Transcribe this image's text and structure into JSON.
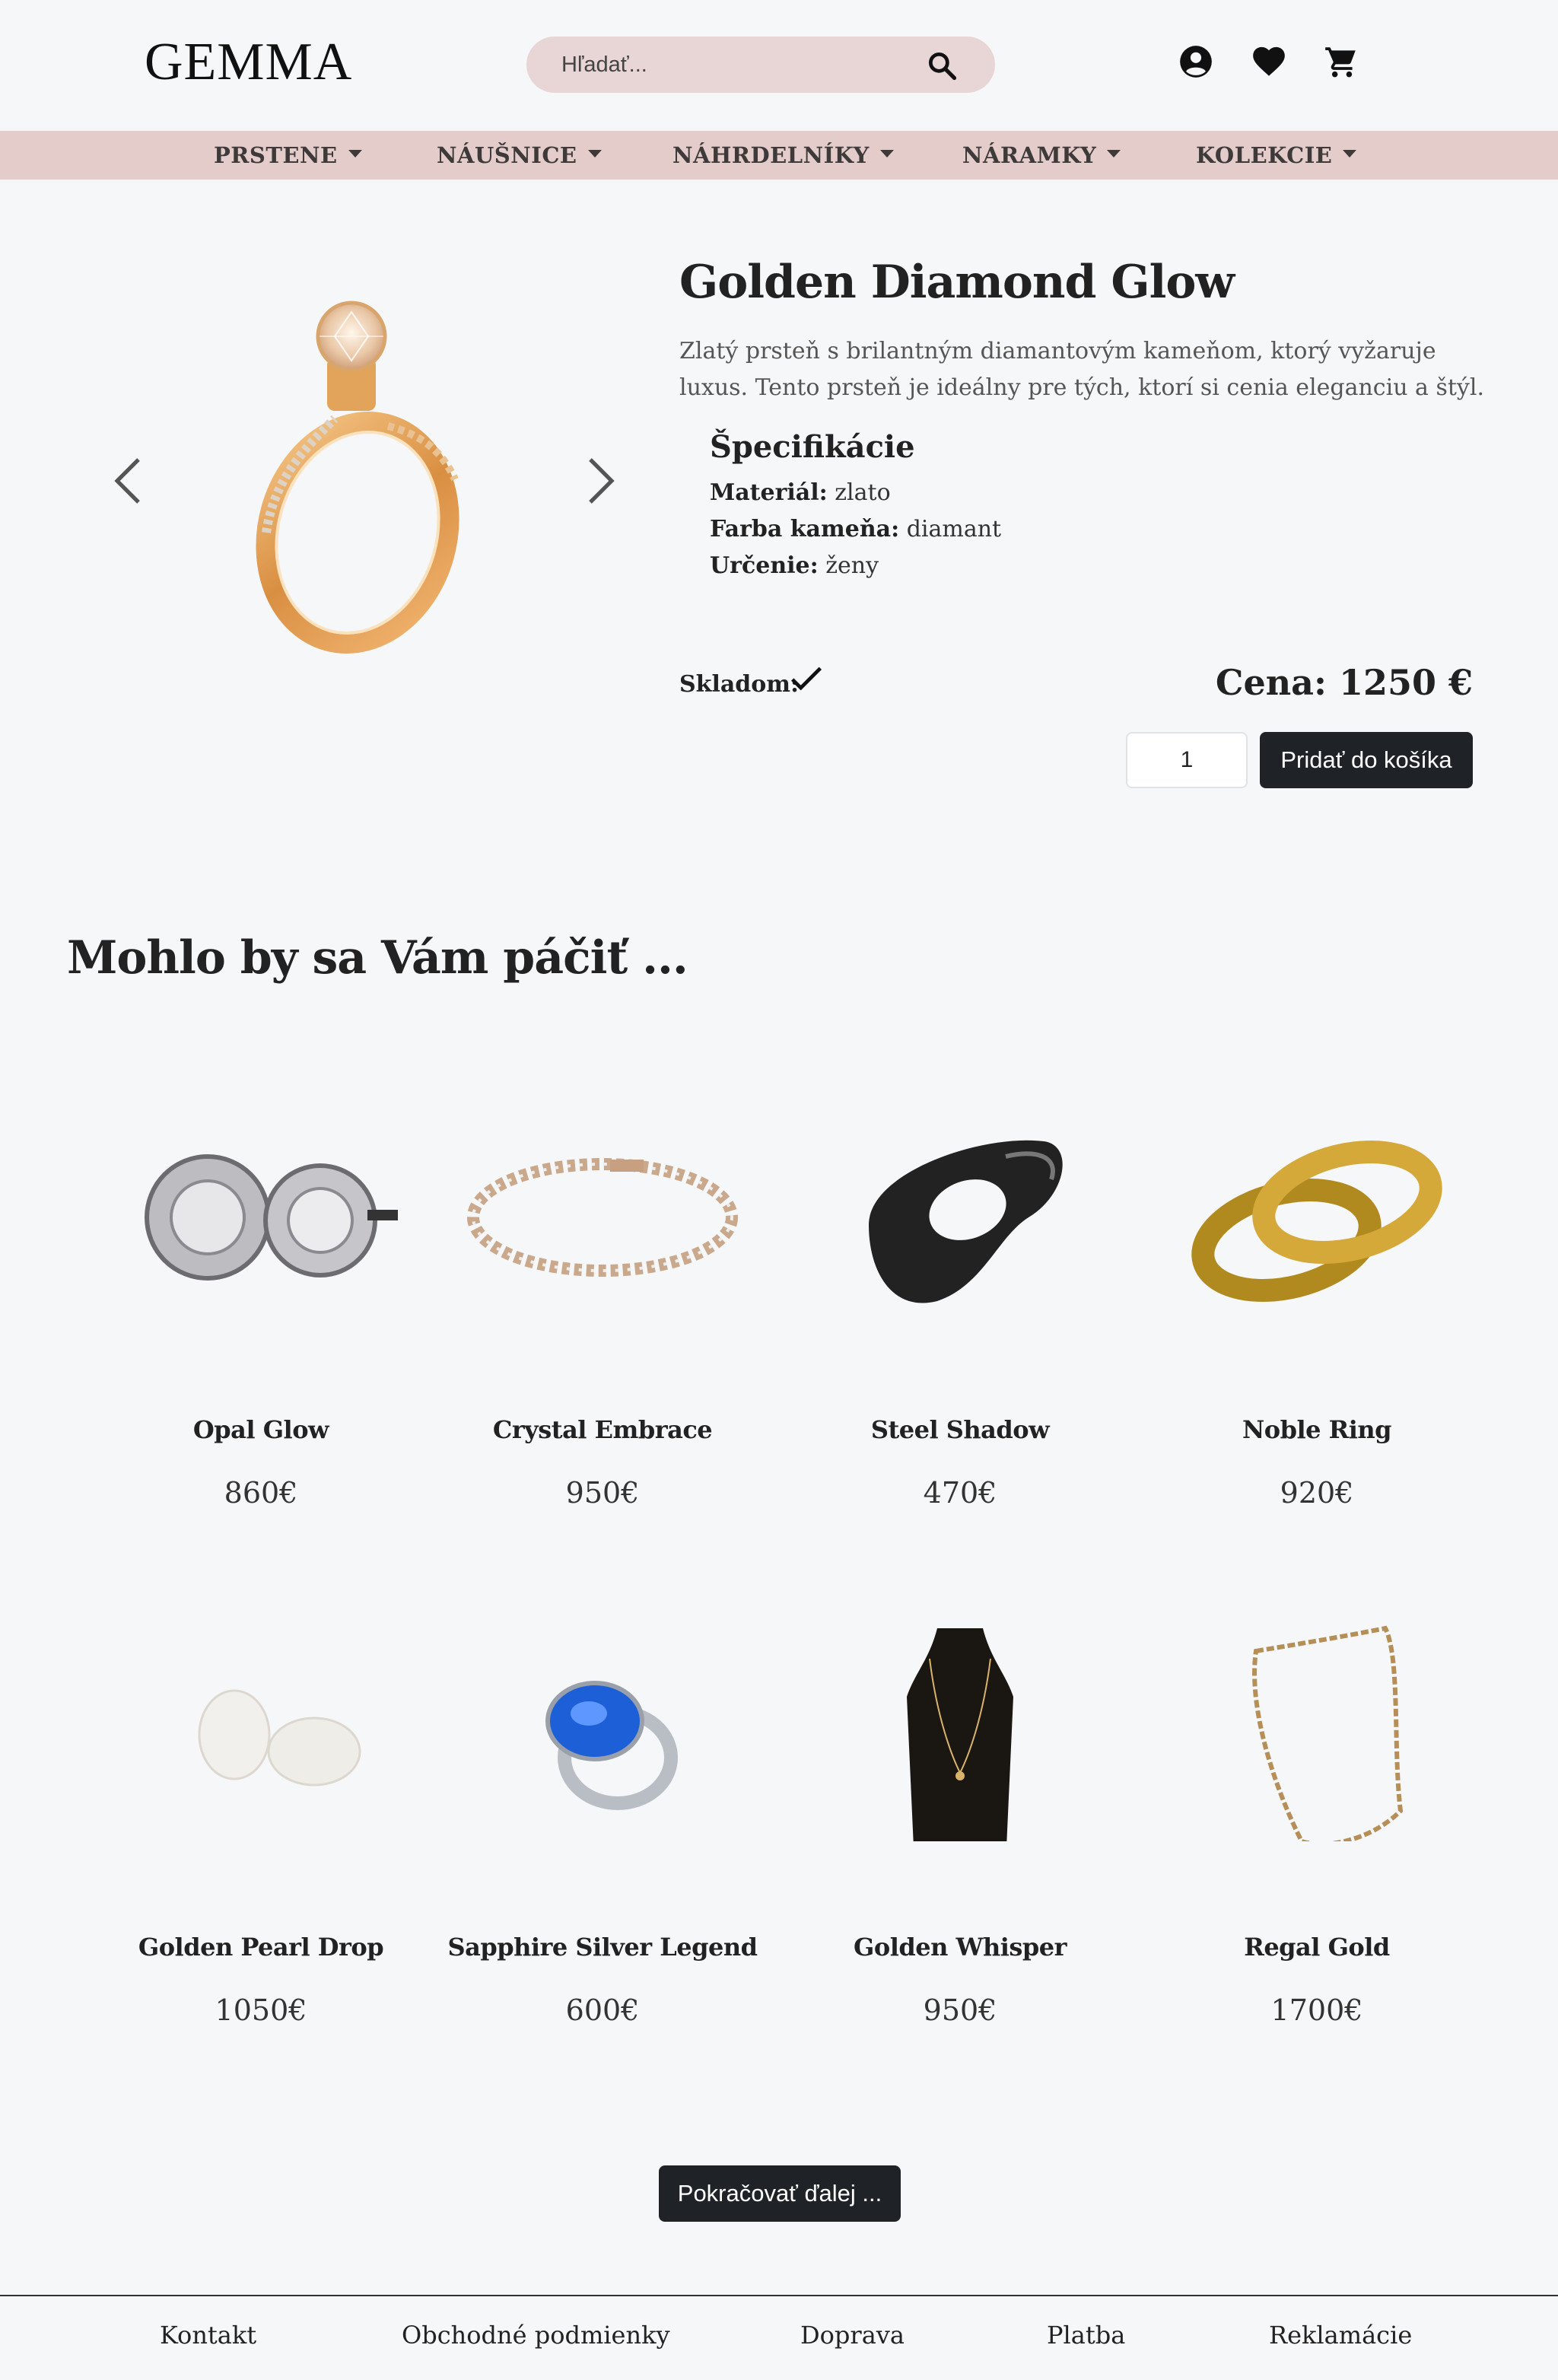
{
  "header": {
    "logo": "GEMMA",
    "search_placeholder": "Hľadať..."
  },
  "nav": [
    {
      "label": "PRSTENE"
    },
    {
      "label": "NÁUŠNICE"
    },
    {
      "label": "NÁHRDELNÍKY"
    },
    {
      "label": "NÁRAMKY"
    },
    {
      "label": "KOLEKCIE"
    }
  ],
  "product": {
    "title": "Golden Diamond Glow",
    "description": "Zlatý prsteň s brilantným diamantovým kameňom, ktorý vyžaruje luxus. Tento prsteň je ideálny pre tých, ktorí si cenia eleganciu a štýl.",
    "spec_title": "Špecifikácie",
    "specs": [
      {
        "label": "Materiál:",
        "value": "zlato"
      },
      {
        "label": "Farba kameňa:",
        "value": "diamant"
      },
      {
        "label": "Určenie:",
        "value": "ženy"
      }
    ],
    "stock_label": "Skladom:",
    "price": "Cena: 1250 €",
    "quantity": "1",
    "add_button": "Pridať do košíka"
  },
  "recommended": {
    "title": "Mohlo by sa Vám páčiť ...",
    "items": [
      {
        "name": "Opal Glow",
        "price": "860€",
        "icon": "earrings-icon"
      },
      {
        "name": "Crystal Embrace",
        "price": "950€",
        "icon": "bracelet-icon"
      },
      {
        "name": "Steel Shadow",
        "price": "470€",
        "icon": "ring-icon"
      },
      {
        "name": "Noble Ring",
        "price": "920€",
        "icon": "ring-icon"
      },
      {
        "name": "Golden Pearl Drop",
        "price": "1050€",
        "icon": "earrings-icon"
      },
      {
        "name": "Sapphire Silver Legend",
        "price": "600€",
        "icon": "ring-icon"
      },
      {
        "name": "Golden Whisper",
        "price": "950€",
        "icon": "necklace-icon"
      },
      {
        "name": "Regal Gold",
        "price": "1700€",
        "icon": "necklace-icon"
      }
    ],
    "more_button": "Pokračovať ďalej ..."
  },
  "footer": {
    "links": [
      "Kontakt",
      "Obchodné podmienky",
      "Doprava",
      "Platba",
      "Reklamácie"
    ]
  },
  "colors": {
    "background": "#f6f7f9",
    "nav": "#e4cccb",
    "search": "#e8d6d6",
    "button": "#1f2226"
  }
}
